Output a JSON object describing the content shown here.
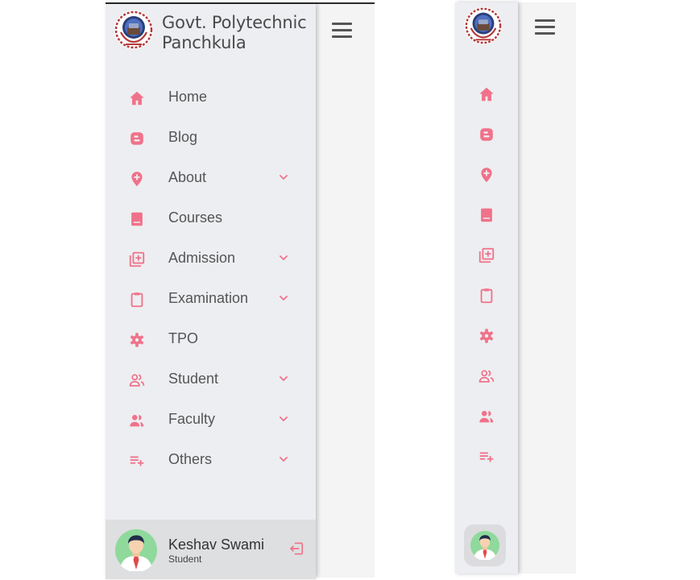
{
  "brand": {
    "title_line1": "Govt. Polytechnic",
    "title_line2": "Panchkula"
  },
  "accent_color": "#f0728a",
  "nav": [
    {
      "label": "Home",
      "icon": "home-icon",
      "has_submenu": false
    },
    {
      "label": "Blog",
      "icon": "blogger-icon",
      "has_submenu": false
    },
    {
      "label": "About",
      "icon": "map-marker-plus-icon",
      "has_submenu": true
    },
    {
      "label": "Courses",
      "icon": "book-icon",
      "has_submenu": false
    },
    {
      "label": "Admission",
      "icon": "library-add-icon",
      "has_submenu": true
    },
    {
      "label": "Examination",
      "icon": "clipboard-icon",
      "has_submenu": true
    },
    {
      "label": "TPO",
      "icon": "gear-icon",
      "has_submenu": false
    },
    {
      "label": "Student",
      "icon": "users-outline-icon",
      "has_submenu": true
    },
    {
      "label": "Faculty",
      "icon": "users-icon",
      "has_submenu": true
    },
    {
      "label": "Others",
      "icon": "playlist-add-icon",
      "has_submenu": true
    }
  ],
  "profile": {
    "name": "Keshav Swami",
    "role": "Student"
  }
}
